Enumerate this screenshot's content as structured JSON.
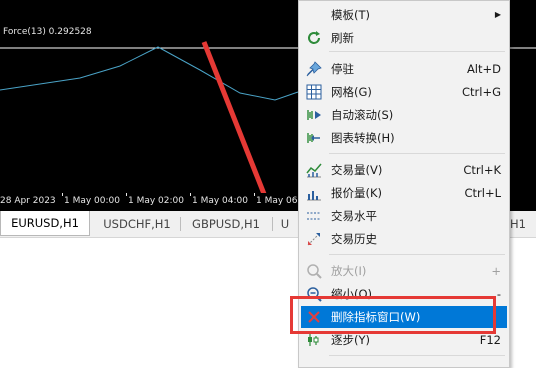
{
  "chart": {
    "indicator_label": "Force(13) 0.292528",
    "line_color": "#4aa3c7",
    "arrow_color": "#e53935"
  },
  "time_axis": {
    "ticks": [
      "28 Apr 2023",
      "1 May 00:00",
      "1 May 02:00",
      "1 May 04:00",
      "1 May 06"
    ]
  },
  "tabs": [
    {
      "label": "EURUSD,H1",
      "active": true
    },
    {
      "label": "USDCHF,H1",
      "active": false
    },
    {
      "label": "GBPUSD,H1",
      "active": false
    },
    {
      "label": "U",
      "active": false
    },
    {
      "label": "H1",
      "active": false
    }
  ],
  "menu": {
    "items": [
      {
        "id": "template",
        "label": "模板(T)",
        "shortcut": "",
        "icon": "none",
        "submenu": true
      },
      {
        "id": "refresh",
        "label": "刷新",
        "shortcut": "",
        "icon": "refresh-icon"
      },
      {
        "id": "dock",
        "label": "停驻",
        "shortcut": "Alt+D",
        "icon": "pin-icon"
      },
      {
        "id": "grid",
        "label": "网格(G)",
        "shortcut": "Ctrl+G",
        "icon": "grid-icon"
      },
      {
        "id": "autoscroll",
        "label": "自动滚动(S)",
        "shortcut": "",
        "icon": "autoscroll-icon"
      },
      {
        "id": "chartshift",
        "label": "图表转换(H)",
        "shortcut": "",
        "icon": "chart-shift-icon"
      },
      {
        "id": "volume",
        "label": "交易量(V)",
        "shortcut": "Ctrl+K",
        "icon": "volume-icon"
      },
      {
        "id": "tickvol",
        "label": "报价量(K)",
        "shortcut": "Ctrl+L",
        "icon": "tick-volume-icon"
      },
      {
        "id": "tradelevels",
        "label": "交易水平",
        "shortcut": "",
        "icon": "trade-levels-icon"
      },
      {
        "id": "tradehistory",
        "label": "交易历史",
        "shortcut": "",
        "icon": "trade-history-icon"
      },
      {
        "id": "zoomin",
        "label": "放大(I)",
        "shortcut": "+",
        "icon": "zoom-in-icon"
      },
      {
        "id": "zoomout",
        "label": "缩小(O)",
        "shortcut": "-",
        "icon": "zoom-out-icon"
      },
      {
        "id": "delete",
        "label": "删除指标窗口(W)",
        "shortcut": "",
        "icon": "delete-icon"
      },
      {
        "id": "step",
        "label": "逐步(Y)",
        "shortcut": "F12",
        "icon": "step-icon"
      }
    ]
  }
}
